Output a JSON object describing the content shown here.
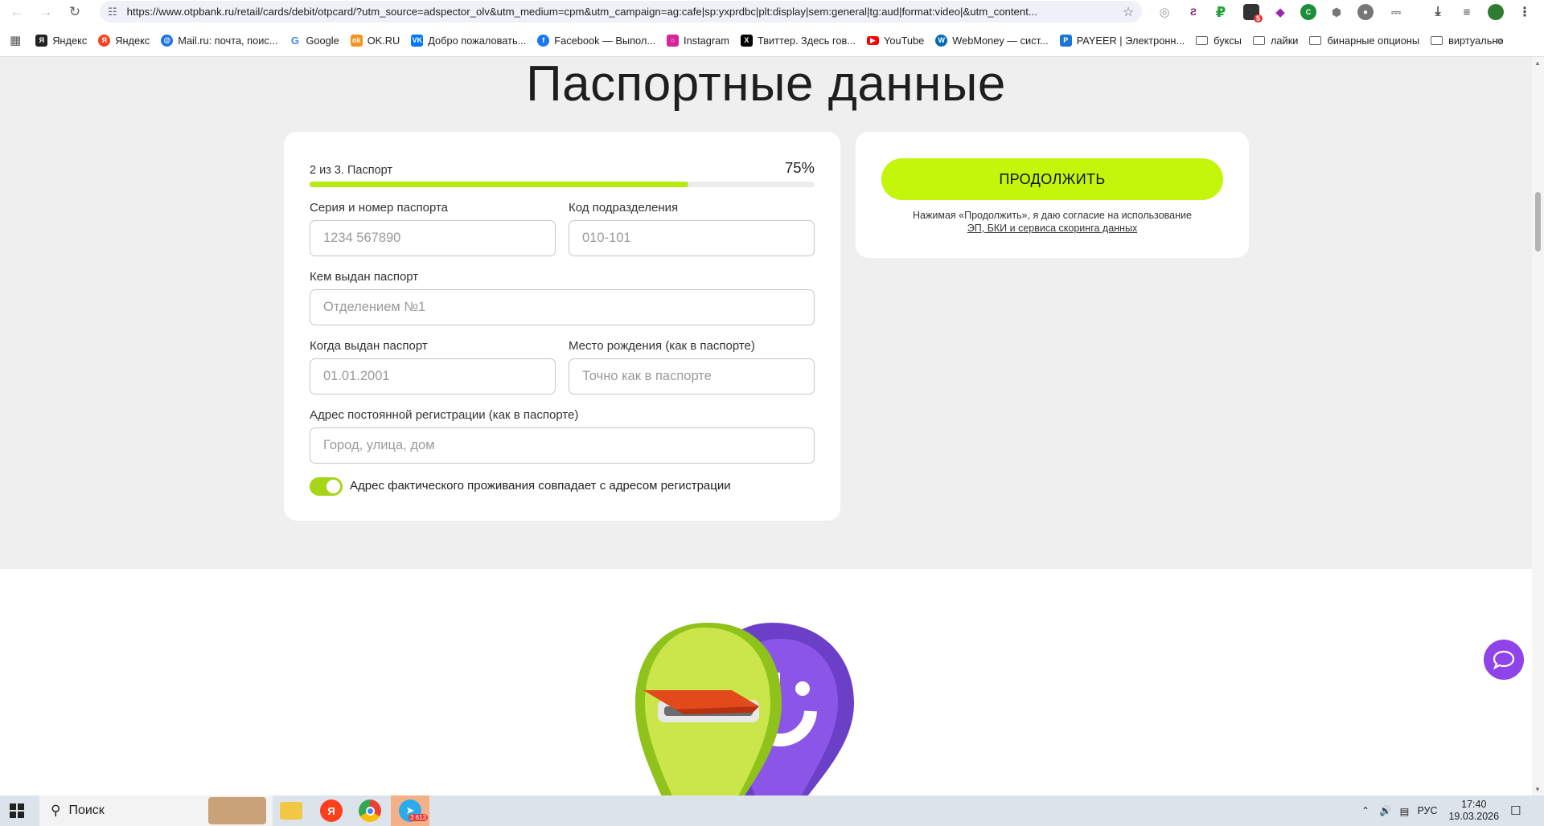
{
  "browser": {
    "url": "https://www.otpbank.ru/retail/cards/debit/otpcard/?utm_source=adspector_olv&utm_medium=cpm&utm_campaign=ag:cafe|sp:yxprdbc|plt:display|sem:general|tg:aud|format:video|&utm_content...",
    "extension_badge": "5",
    "bookmarks": [
      "Яндекс",
      "Яндекс",
      "Mail.ru: почта, поис...",
      "Google",
      "OK.RU",
      "Добро пожаловать...",
      "Facebook — Выпол...",
      "Instagram",
      "Твиттер. Здесь гов...",
      "YouTube",
      "WebMoney — сист...",
      "PAYEER | Электронн..."
    ],
    "bookmark_folders": [
      "буксы",
      "лайки",
      "бинарные опционы",
      "виртуально"
    ],
    "more_bookmarks": "»"
  },
  "page": {
    "title": "Паспортные данные",
    "step_text": "2 из 3. Паспорт",
    "progress_label": "75%",
    "progress_fraction": 0.75,
    "fields": {
      "series_label": "Серия и номер паспорта",
      "series_placeholder": "1234 567890",
      "code_label": "Код подразделения",
      "code_placeholder": "010-101",
      "issued_by_label": "Кем выдан паспорт",
      "issued_by_placeholder": "Отделением №1",
      "issued_date_label": "Когда выдан паспорт",
      "issued_date_placeholder": "01.01.2001",
      "birthplace_label": "Место рождения (как в паспорте)",
      "birthplace_placeholder": "Точно как в паспорте",
      "address_label": "Адрес постоянной регистрации (как в паспорте)",
      "address_placeholder": "Город, улица, дом"
    },
    "toggle_label": "Адрес фактического проживания совпадает с адресом регистрации",
    "toggle_on": true,
    "continue_button": "ПРОДОЛЖИТЬ",
    "consent_text": "Нажимая «Продолжить», я даю согласие на использование",
    "consent_link": "ЭП, БКИ и сервиса скоринга данных"
  },
  "taskbar": {
    "search_label": "Поиск",
    "telegram_badge": "3 613",
    "language": "РУС",
    "time": "17:40",
    "date": "19.03.2026"
  },
  "colors": {
    "accent": "#c3f60b",
    "progress": "#b7ea10",
    "chat": "#8e44e8"
  }
}
